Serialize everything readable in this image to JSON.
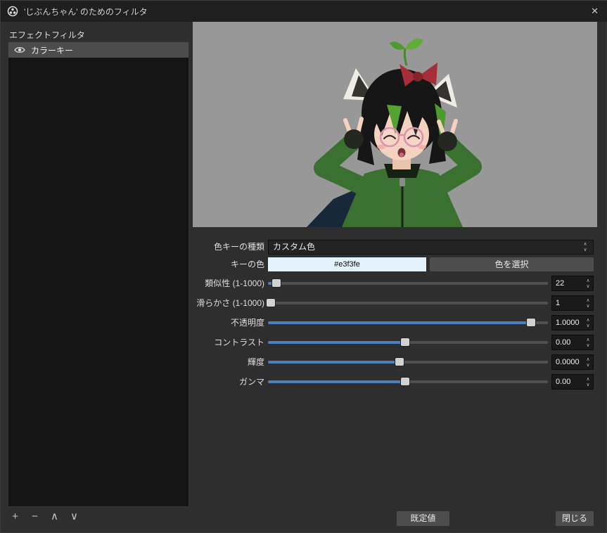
{
  "titlebar": {
    "title": "'じぶんちゃん' のためのフィルタ",
    "close_icon": "✕"
  },
  "icons": {
    "plus": "+",
    "minus": "−",
    "chevron_up": "∧",
    "chevron_down": "∨"
  },
  "left_panel": {
    "header": "エフェクトフィルタ",
    "items": [
      {
        "label": "カラーキー",
        "visible": true
      }
    ]
  },
  "properties": {
    "rows": [
      {
        "label": "色キーの種類",
        "type": "combo",
        "value": "カスタム色"
      },
      {
        "label": "キーの色",
        "type": "color",
        "value": "#e3f3fe",
        "button_label": "色を選択"
      },
      {
        "label": "類似性 (1-1000)",
        "type": "slider",
        "value": "22",
        "percent": 3
      },
      {
        "label": "滑らかさ (1-1000)",
        "type": "slider",
        "value": "1",
        "percent": 1
      },
      {
        "label": "不透明度",
        "type": "slider",
        "value": "1.0000",
        "percent": 94
      },
      {
        "label": "コントラスト",
        "type": "slider",
        "value": "0.00",
        "percent": 49
      },
      {
        "label": "輝度",
        "type": "slider",
        "value": "0.0000",
        "percent": 47
      },
      {
        "label": "ガンマ",
        "type": "slider",
        "value": "0.00",
        "percent": 49
      }
    ]
  },
  "footer": {
    "defaults_label": "既定値",
    "close_label": "閉じる"
  },
  "colors": {
    "accent": "#4c7fc0",
    "key_color": "#e3f3fe",
    "preview_background": "#989898"
  }
}
